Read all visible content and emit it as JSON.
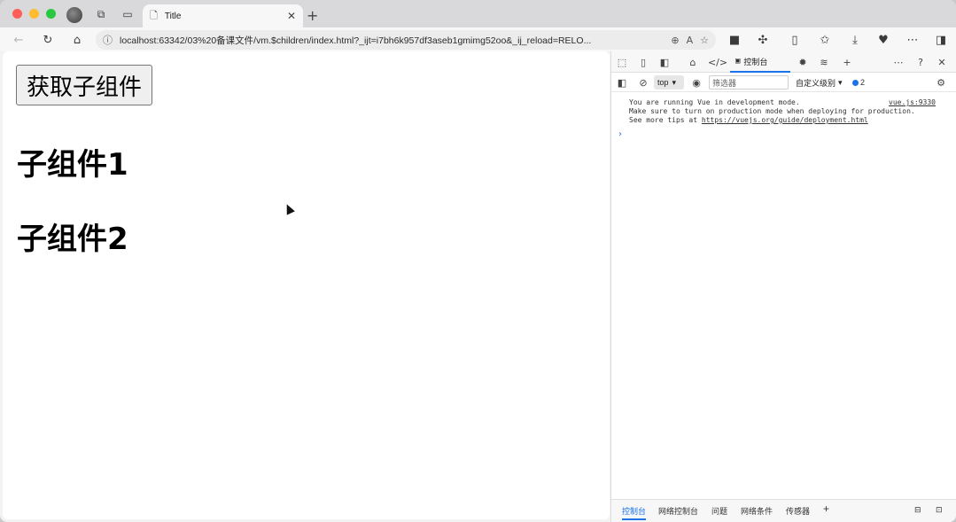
{
  "browser": {
    "tab": {
      "title": "Title"
    },
    "address": {
      "url": "localhost:63342/03%20备课文件/vm.$children/index.html?_ijt=i7bh6k957df3aseb1gmimg52oo&_ij_reload=RELO..."
    }
  },
  "page": {
    "button_label": "获取子组件",
    "child1": "子组件1",
    "child2": "子组件2"
  },
  "devtools": {
    "console_tab": "控制台",
    "context": "top",
    "filter_placeholder": "筛选器",
    "level": "自定义级别",
    "issues_count": "2",
    "message": {
      "line1": "You are running Vue in development mode.",
      "line2": "Make sure to turn on production mode when deploying for production.",
      "line3_prefix": "See more tips at ",
      "link": "https://vuejs.org/guide/deployment.html",
      "source": "vue.js:9330"
    },
    "drawer_tabs": [
      "控制台",
      "网络控制台",
      "问题",
      "网络条件",
      "传感器"
    ]
  }
}
